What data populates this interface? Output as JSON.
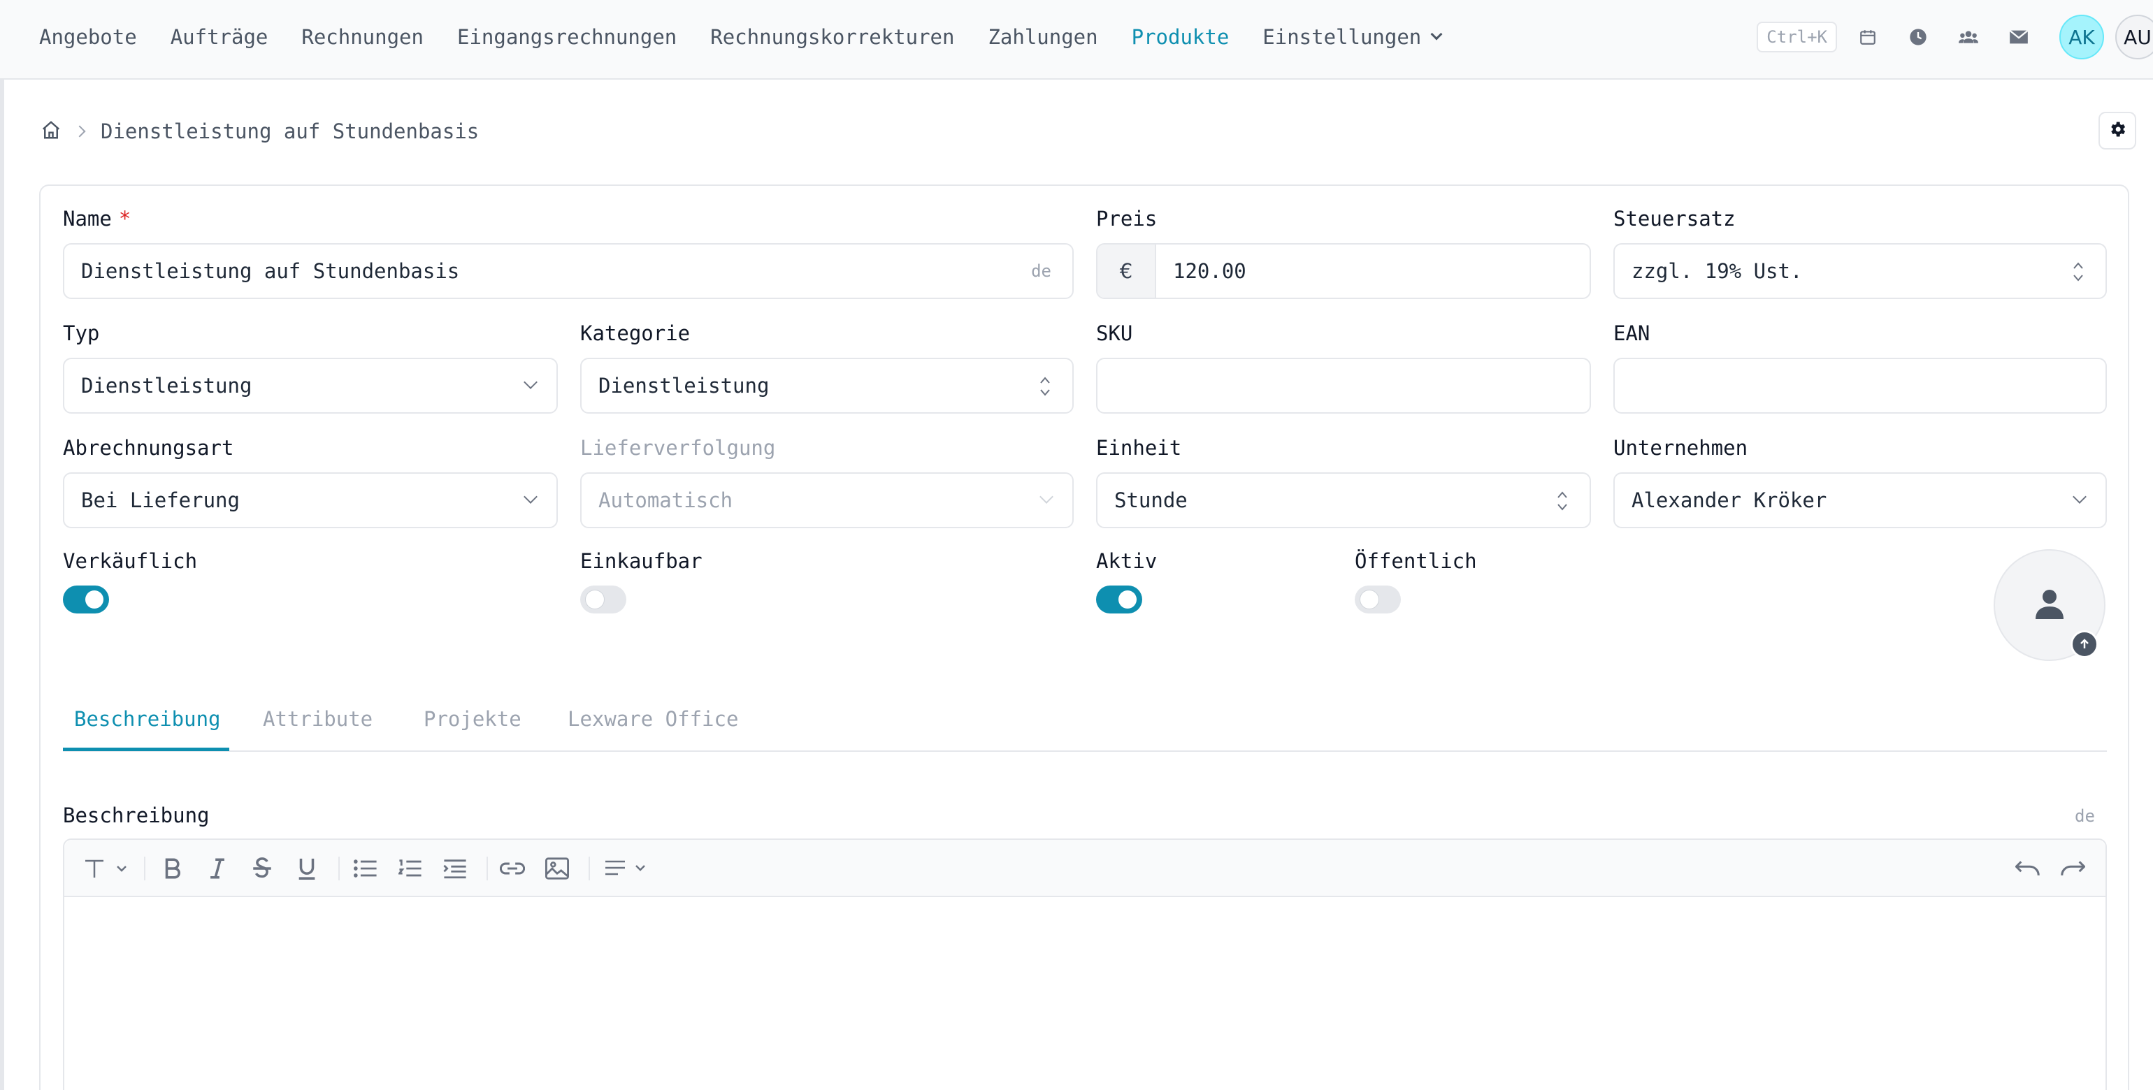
{
  "nav": {
    "items": [
      {
        "label": "Angebote",
        "active": false
      },
      {
        "label": "Aufträge",
        "active": false
      },
      {
        "label": "Rechnungen",
        "active": false
      },
      {
        "label": "Eingangsrechnungen",
        "active": false
      },
      {
        "label": "Rechnungskorrekturen",
        "active": false
      },
      {
        "label": "Zahlungen",
        "active": false
      },
      {
        "label": "Produkte",
        "active": true
      }
    ],
    "settings_label": "Einstellungen",
    "shortcut": "Ctrl+K",
    "tool_icons": [
      "calendar-icon",
      "clock-icon",
      "users-icon",
      "mail-icon"
    ],
    "avatar_1": "AK",
    "avatar_2": "AU"
  },
  "breadcrumb": {
    "current": "Dienstleistung auf Stundenbasis"
  },
  "form": {
    "name": {
      "label": "Name",
      "required_mark": "*",
      "value": "Dienstleistung auf Stundenbasis",
      "locale": "de"
    },
    "price": {
      "label": "Preis",
      "currency": "€",
      "value": "120.00"
    },
    "tax": {
      "label": "Steuersatz",
      "value": "zzgl. 19% Ust."
    },
    "type": {
      "label": "Typ",
      "value": "Dienstleistung"
    },
    "category": {
      "label": "Kategorie",
      "value": "Dienstleistung"
    },
    "sku": {
      "label": "SKU",
      "value": ""
    },
    "ean": {
      "label": "EAN",
      "value": ""
    },
    "billing": {
      "label": "Abrechnungsart",
      "value": "Bei Lieferung"
    },
    "tracking": {
      "label": "Lieferverfolgung",
      "value": "Automatisch",
      "disabled": true
    },
    "unit": {
      "label": "Einheit",
      "value": "Stunde"
    },
    "company": {
      "label": "Unternehmen",
      "value": "Alexander Kröker"
    },
    "sellable": {
      "label": "Verkäuflich",
      "on": true
    },
    "purchasable": {
      "label": "Einkaufbar",
      "on": false
    },
    "active": {
      "label": "Aktiv",
      "on": true
    },
    "public": {
      "label": "Öffentlich",
      "on": false
    }
  },
  "tabs": [
    {
      "label": "Beschreibung",
      "active": true
    },
    {
      "label": "Attribute",
      "active": false
    },
    {
      "label": "Projekte",
      "active": false
    },
    {
      "label": "Lexware Office",
      "active": false
    }
  ],
  "description": {
    "label": "Beschreibung",
    "locale": "de",
    "content": ""
  },
  "colors": {
    "accent": "#0e8fb0",
    "required": "#dc2626",
    "avatar_bg": "#a5f3fc"
  }
}
